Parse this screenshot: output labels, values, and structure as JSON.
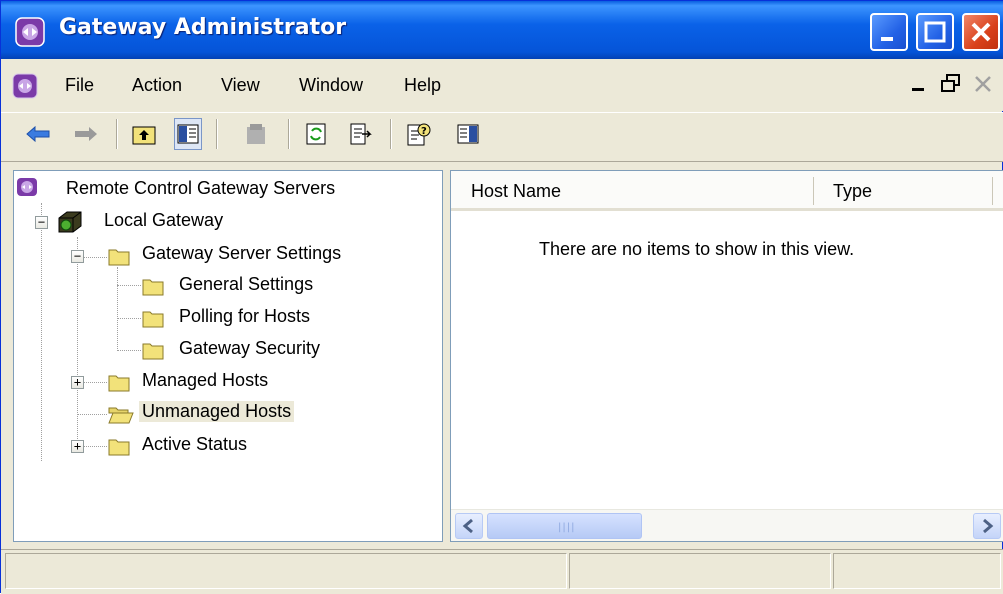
{
  "window": {
    "title": "Gateway Administrator"
  },
  "menu": {
    "items": [
      "File",
      "Action",
      "View",
      "Window",
      "Help"
    ]
  },
  "toolbar": {
    "buttons": [
      "back-icon",
      "forward-icon",
      "up-folder-icon",
      "show-hide-tree-icon",
      "delete-icon",
      "refresh-icon",
      "export-list-icon",
      "help-icon",
      "console-view-icon"
    ]
  },
  "tree": {
    "root": "Remote Control Gateway Servers",
    "local_gateway": "Local Gateway",
    "gateway_server_settings": "Gateway Server Settings",
    "general_settings": "General Settings",
    "polling_for_hosts": "Polling for Hosts",
    "gateway_security": "Gateway Security",
    "managed_hosts": "Managed Hosts",
    "unmanaged_hosts": "Unmanaged Hosts",
    "active_status": "Active Status",
    "selected": "Unmanaged Hosts"
  },
  "list": {
    "columns": [
      "Host Name",
      "Type"
    ],
    "empty_message": "There are no items to show in this view."
  },
  "colors": {
    "titlebar": "#0a5fe0",
    "folder": "#f2e27a",
    "gateway_box": "#4caf30"
  }
}
